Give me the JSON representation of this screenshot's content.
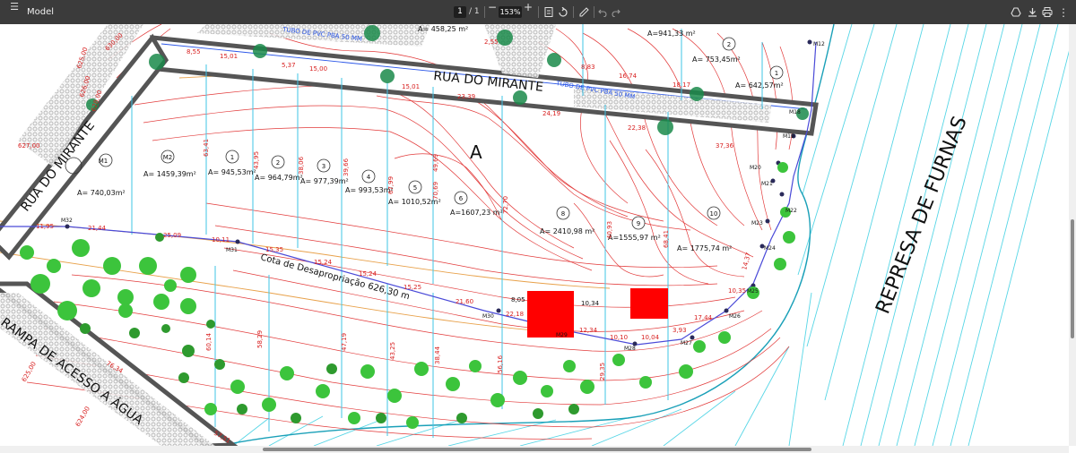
{
  "toolbar": {
    "menu_icon": "hamburger-icon",
    "title": "Model",
    "page_current": "1",
    "page_sep": "/ 1",
    "zoom_out": "−",
    "zoom": "153%",
    "zoom_in": "+",
    "fit_icon": "fit-page-icon",
    "rotate_icon": "rotate-icon",
    "annotate_icon": "annotate-icon",
    "undo_icon": "undo-icon",
    "redo_icon": "redo-icon",
    "drive_icon": "drive-icon",
    "download_icon": "download-icon",
    "print_icon": "print-icon",
    "more_icon": "more-vertical-icon"
  },
  "drawing": {
    "street_main": "RUA DO MIRANTE",
    "street_side": "RUA DO MIRANTE",
    "ramp": "RAMPA DE ACESSO A ÁGUA",
    "reservoir": "REPRESA DE FURNAS",
    "block": "A",
    "pipe1": "TUBO DE PVC PBA 50 MM",
    "pipe2": "TUBO DE PVC PBA 50 MM",
    "expropriation": "Cota de Desapropriação 626,30 m",
    "lots": [
      {
        "num": "M1",
        "area": "A= 740,03m²"
      },
      {
        "num": "M2",
        "area": "A= 1459,39m²"
      },
      {
        "num": "1",
        "area": "A= 945,53m²"
      },
      {
        "num": "2",
        "area": "A= 964,79m²"
      },
      {
        "num": "3",
        "area": "A= 977,39m²"
      },
      {
        "num": "4",
        "area": "A= 993,53m²"
      },
      {
        "num": "5",
        "area": "A= 1010,52m²"
      },
      {
        "num": "6",
        "area": "A=1607,23 m²"
      },
      {
        "num": "8",
        "area": "A= 2410,98 m²"
      },
      {
        "num": "9",
        "area": "A=1555,97 m²"
      },
      {
        "num": "10",
        "area": "A= 1775,74 m²"
      }
    ],
    "top_lots": [
      {
        "num": "",
        "area": "A= 458,25 m²"
      },
      {
        "num": "",
        "area": "A=941,33 m²"
      },
      {
        "num": "2",
        "area": "A= 753,45m²"
      },
      {
        "num": "1",
        "area": "A= 642,57m²"
      }
    ],
    "markers": [
      "M32",
      "M31",
      "M30",
      "M29",
      "M28",
      "M27",
      "M26",
      "M25",
      "M24",
      "M23",
      "M22",
      "M21",
      "M20",
      "M19",
      "M18",
      "M12"
    ],
    "dims": [
      "11,95",
      "21,44",
      "25,09",
      "10,11",
      "15,35",
      "15,24",
      "15,24",
      "15,25",
      "21,60",
      "22,18",
      "12,34",
      "10,10",
      "10,04",
      "3,93",
      "17,44",
      "10,35",
      "14,37",
      "8,05",
      "10,34",
      "15,01",
      "5,37",
      "15,00",
      "15,01",
      "23,39",
      "24,19",
      "22,38",
      "37,36",
      "18,17",
      "16,74",
      "8,83",
      "8,55",
      "2,55"
    ],
    "levels": [
      "625,00",
      "626,00",
      "627,00",
      "628,00",
      "624,00",
      "625,00",
      "630,00"
    ],
    "lot_widths": [
      "63,41",
      "43,95",
      "38,06",
      "39,66",
      "67,99",
      "70,69",
      "49,69",
      "72,70",
      "68,41",
      "40,93",
      "47,19",
      "58,29",
      "60,14",
      "43,25",
      "38,44",
      "56,16",
      "29,35",
      "76,34",
      "57,51"
    ]
  }
}
